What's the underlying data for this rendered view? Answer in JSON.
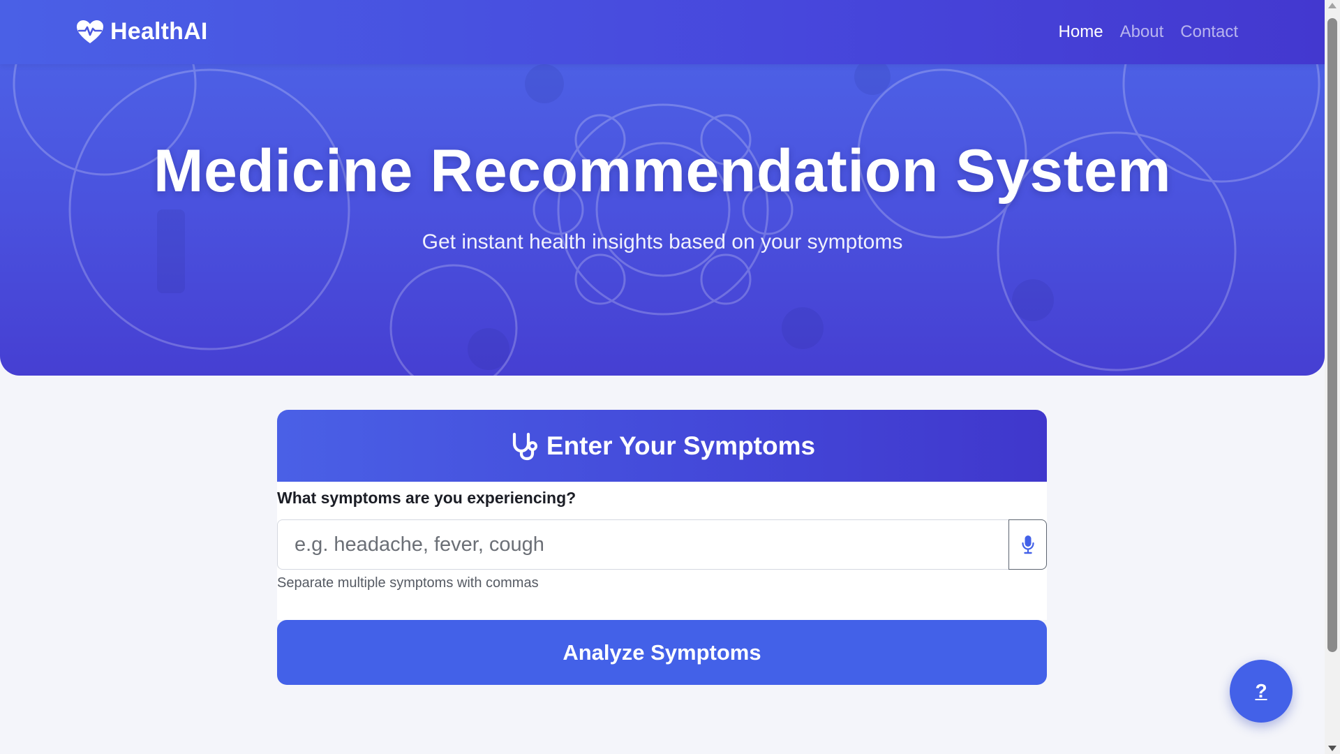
{
  "navbar": {
    "brand": "HealthAI",
    "links": [
      {
        "label": "Home",
        "active": true
      },
      {
        "label": "About",
        "active": false
      },
      {
        "label": "Contact",
        "active": false
      }
    ]
  },
  "hero": {
    "title": "Medicine Recommendation System",
    "subtitle": "Get instant health insights based on your symptoms"
  },
  "card": {
    "header_title": "Enter Your Symptoms",
    "header_icon": "stethoscope-icon",
    "field_label": "What symptoms are you experiencing?",
    "input_value": "",
    "input_placeholder": "e.g. headache, fever, cough",
    "mic_icon": "microphone-icon",
    "help_text": "Separate multiple symptoms with commas",
    "submit_label": "Analyze Symptoms"
  },
  "help_fab": {
    "label": "?"
  },
  "colors": {
    "primary": "#4361e8",
    "gradient_start": "#4a60e6",
    "gradient_end": "#4338cf",
    "page_background": "#f4f5fa"
  }
}
